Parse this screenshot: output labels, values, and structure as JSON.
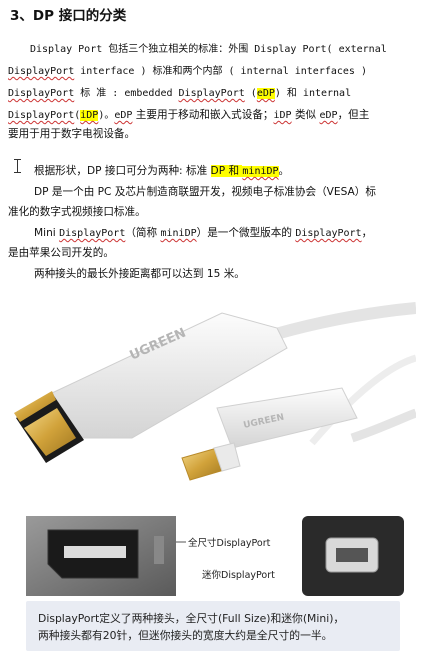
{
  "heading": "3、DP 接口的分类",
  "p1": {
    "l1_a": "Display Port 包括三个独立相关的标准：外围 Display Port( external",
    "l2_a": "DisplayPort",
    "l2_b": " interface ) 标准和两个内部 ( internal interfaces )",
    "l3_a": "DisplayPort",
    "l3_b": " 标 准 : embedded ",
    "l3_c": "DisplayPort",
    "l3_d": " (",
    "l3_e": "eDP",
    "l3_f": ") 和 internal",
    "l4_a": "DisplayPort",
    "l4_b": "(",
    "l4_c": "iDP",
    "l4_d": ")。",
    "l4_e": "eDP",
    "l4_f": " 主要用于移动和嵌入式设备；",
    "l4_g": "iDP",
    "l4_h": " 类似 ",
    "l4_i": "eDP",
    "l4_j": "，但主",
    "l5": "要用于用于数字电视设备。"
  },
  "p2": {
    "a": "根据形状，DP 接口可分为两种: 标准 ",
    "b": "DP 和 ",
    "c": "miniDP",
    "d": "。"
  },
  "p3": {
    "l1": "DP 是一个由 PC 及芯片制造商联盟开发，视频电子标准协会（VESA）标",
    "l2": "准化的数字式视频接口标准。"
  },
  "p4": {
    "l1_a": "Mini ",
    "l1_b": "DisplayPort",
    "l1_c": "（简称 ",
    "l1_d": "miniDP",
    "l1_e": "）是一个微型版本的 ",
    "l1_f": "DisplayPort",
    "l1_g": "，",
    "l2": "是由苹果公司开发的。"
  },
  "p5": "两种接头的最长外接距离都可以达到 15 米。",
  "photo": {
    "brand_cable": "UGREEN",
    "brand_plug": "UGREEN"
  },
  "photo2": {
    "label_full": "全尺寸DisplayPort",
    "label_mini": "迷你DisplayPort"
  },
  "caption": {
    "l1": "DisplayPort定义了两种接头，全尺寸(Full Size)和迷你(Mini)，",
    "l2": "两种接头都有20针，但迷你接头的宽度大约是全尺寸的一半。"
  }
}
